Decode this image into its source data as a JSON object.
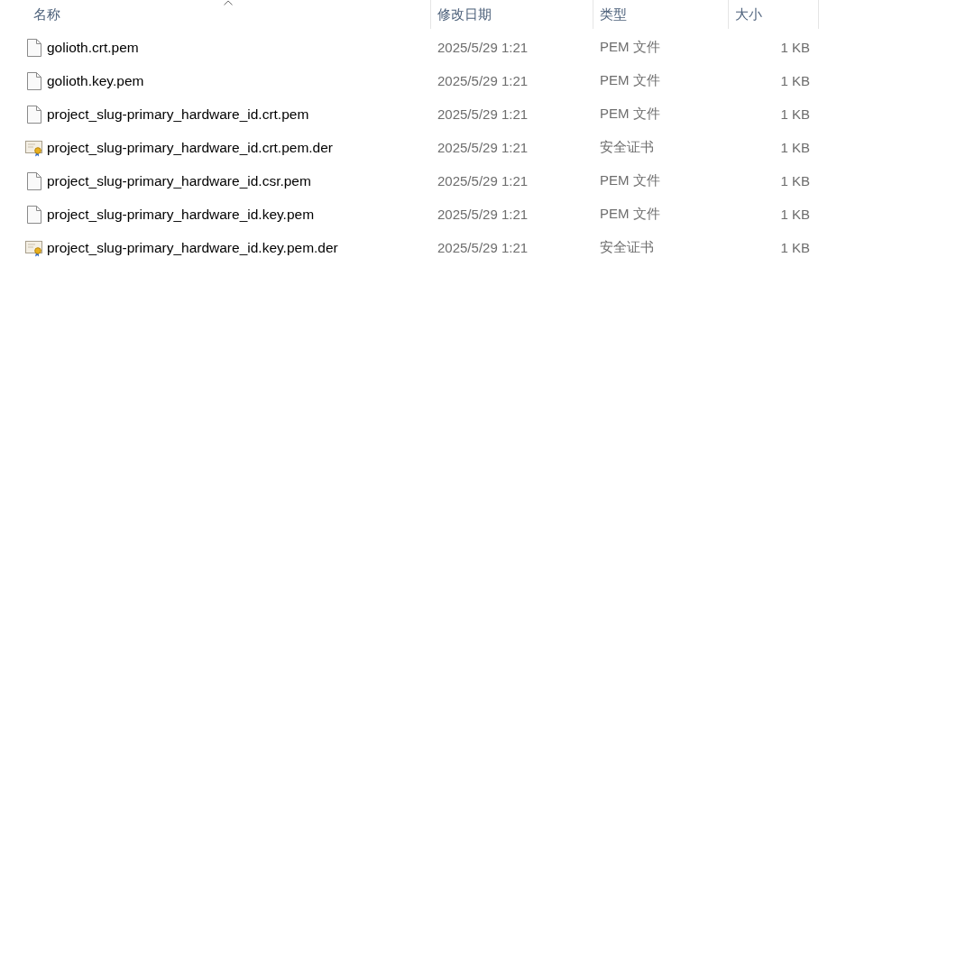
{
  "columns": [
    {
      "label": "名称",
      "sorted": true
    },
    {
      "label": "修改日期",
      "sorted": false
    },
    {
      "label": "类型",
      "sorted": false
    },
    {
      "label": "大小",
      "sorted": false
    }
  ],
  "files": [
    {
      "kind": "file",
      "name": "golioth.crt.pem",
      "modified": "2025/5/29 1:21",
      "type": "PEM 文件",
      "size": "1 KB"
    },
    {
      "kind": "file",
      "name": "golioth.key.pem",
      "modified": "2025/5/29 1:21",
      "type": "PEM 文件",
      "size": "1 KB"
    },
    {
      "kind": "file",
      "name": "project_slug-primary_hardware_id.crt.pem",
      "modified": "2025/5/29 1:21",
      "type": "PEM 文件",
      "size": "1 KB"
    },
    {
      "kind": "certificate",
      "name": "project_slug-primary_hardware_id.crt.pem.der",
      "modified": "2025/5/29 1:21",
      "type": "安全证书",
      "size": "1 KB"
    },
    {
      "kind": "file",
      "name": "project_slug-primary_hardware_id.csr.pem",
      "modified": "2025/5/29 1:21",
      "type": "PEM 文件",
      "size": "1 KB"
    },
    {
      "kind": "file",
      "name": "project_slug-primary_hardware_id.key.pem",
      "modified": "2025/5/29 1:21",
      "type": "PEM 文件",
      "size": "1 KB"
    },
    {
      "kind": "certificate",
      "name": "project_slug-primary_hardware_id.key.pem.der",
      "modified": "2025/5/29 1:21",
      "type": "安全证书",
      "size": "1 KB"
    }
  ]
}
